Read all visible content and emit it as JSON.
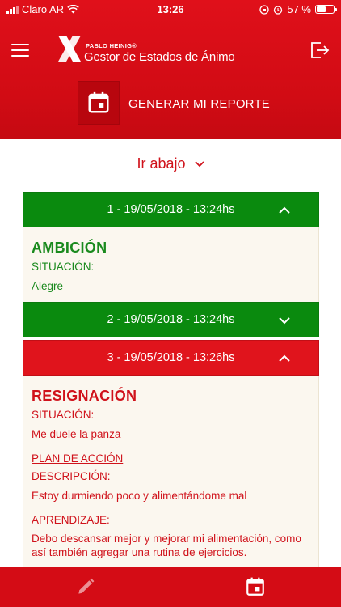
{
  "status_bar": {
    "carrier": "Claro AR",
    "time": "13:26",
    "battery": "57 %",
    "battery_level": 0.57
  },
  "header": {
    "brand_name": "PABLO HEINIG®",
    "app_title": "Gestor de Estados de Ánimo",
    "report_button_label": "GENERAR MI REPORTE"
  },
  "content": {
    "scroll_link": "Ir abajo",
    "entries": [
      {
        "header": "1 - 19/05/2018 - 13:24hs",
        "color": "#0a8a0e",
        "expanded": true,
        "emotion": "AMBICIÓN",
        "situation_label": "SITUACIÓN:",
        "situation": "Alegre"
      },
      {
        "header": "2 - 19/05/2018 - 13:24hs",
        "color": "#0a8a0e",
        "expanded": false
      },
      {
        "header": "3 - 19/05/2018 - 13:26hs",
        "color": "#e0141c",
        "expanded": true,
        "emotion": "RESIGNACIÓN",
        "situation_label": "SITUACIÓN:",
        "situation": "Me duele la panza",
        "plan_label": "PLAN DE ACCIÓN",
        "description_label": "DESCRIPCIÓN:",
        "description": "Estoy durmiendo poco y alimentándome mal",
        "learning_label": "APRENDIZAJE:",
        "learning": "Debo descansar mejor y mejorar mi alimentación, como así también agregar una rutina de ejercicios."
      }
    ]
  },
  "colors": {
    "brand_red": "#d40c15",
    "accent_green": "#0a8a0e",
    "body_bg": "#fbf7ef"
  },
  "icons": {
    "menu": "hamburger-icon",
    "logout": "logout-icon",
    "report": "calendar-icon",
    "edit_tab": "pencil-icon",
    "calendar_tab": "calendar-icon"
  }
}
